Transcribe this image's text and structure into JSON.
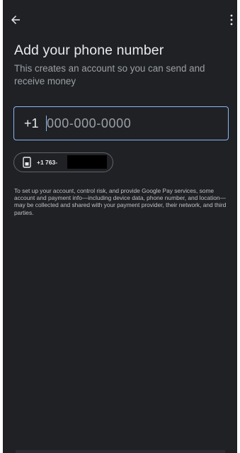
{
  "header": {
    "back_icon": "arrow-back-icon",
    "more_icon": "more-vert-icon"
  },
  "page": {
    "title": "Add your phone number",
    "subtitle": "This creates an account so you can send and receive money"
  },
  "phone": {
    "country_code": "+1",
    "placeholder": "000-000-0000",
    "value": ""
  },
  "suggestion": {
    "icon": "sim-card-icon",
    "label": "+1 763-"
  },
  "disclaimer": "To set up your account, control risk, and provide Google Pay services, some account and payment info—including device data, phone number, and location—may be collected and shared with your payment provider, their network, and third parties.",
  "colors": {
    "background": "#202124",
    "accent": "#8ab4f8",
    "text_primary": "#e8eaed",
    "text_secondary": "#9aa0a6"
  }
}
